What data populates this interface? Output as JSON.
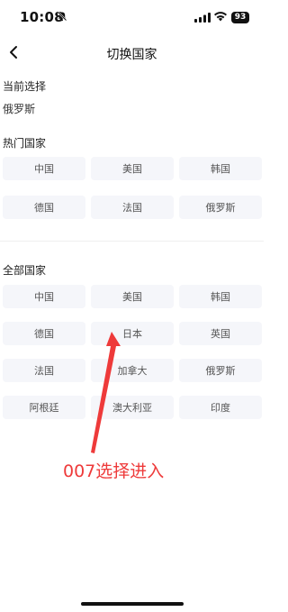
{
  "status_bar": {
    "time": "10:08",
    "battery": "93"
  },
  "nav": {
    "title": "切换国家"
  },
  "current": {
    "title": "当前选择",
    "value": "俄罗斯"
  },
  "hot": {
    "title": "热门国家",
    "countries": [
      "中国",
      "美国",
      "韩国",
      "德国",
      "法国",
      "俄罗斯"
    ]
  },
  "all": {
    "title": "全部国家",
    "countries": [
      "中国",
      "美国",
      "韩国",
      "德国",
      "日本",
      "英国",
      "法国",
      "加拿大",
      "俄罗斯",
      "阿根廷",
      "澳大利亚",
      "印度"
    ]
  },
  "annotation": {
    "text": "007选择进入",
    "color": "#ee3a3a"
  },
  "icons": {
    "back": "chevron-left-icon",
    "bell": "bell-slash-icon",
    "signal": "signal-icon",
    "wifi": "wifi-icon",
    "battery": "battery-icon"
  }
}
